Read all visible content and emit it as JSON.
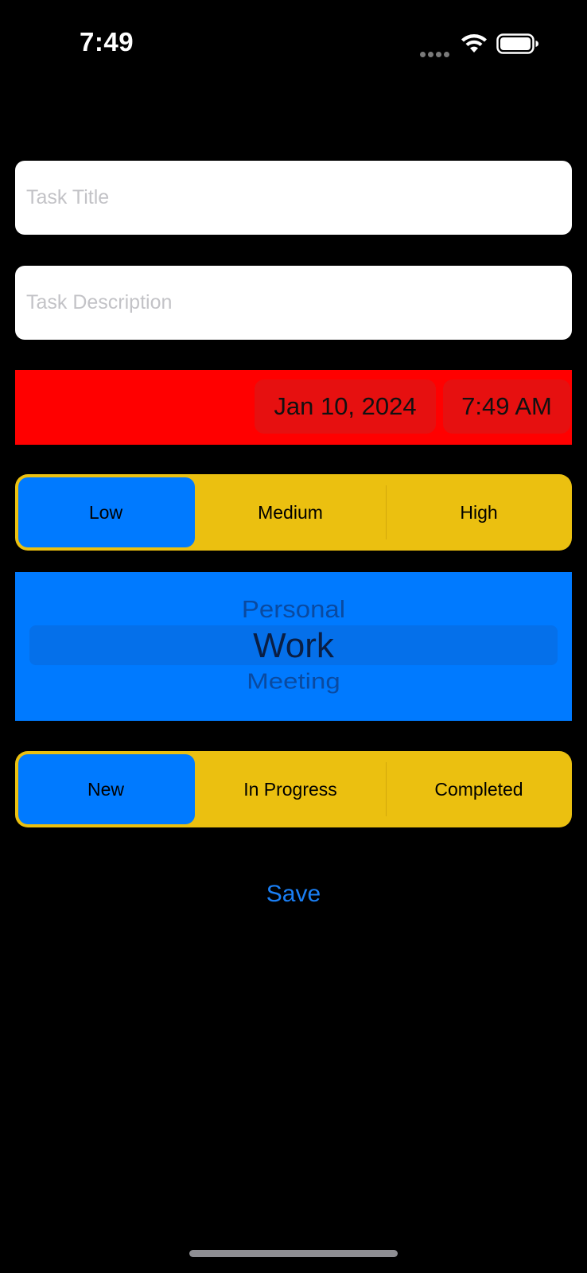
{
  "status_bar": {
    "time": "7:49",
    "icons": [
      "signal-dots-icon",
      "wifi-icon",
      "battery-icon"
    ]
  },
  "form": {
    "title_field": {
      "value": "",
      "placeholder": "Task Title"
    },
    "description_field": {
      "value": "",
      "placeholder": "Task Description"
    },
    "due": {
      "date": "Jan 10, 2024",
      "time": "7:49 AM"
    },
    "priority": {
      "options": [
        "Low",
        "Medium",
        "High"
      ],
      "selected": "Low"
    },
    "category": {
      "visible_options": [
        "Personal",
        "Work",
        "Meeting"
      ],
      "selected": "Work"
    },
    "status": {
      "options": [
        "New",
        "In Progress",
        "Completed"
      ],
      "selected": "New"
    },
    "save_label": "Save"
  },
  "colors": {
    "background": "#000000",
    "date_row": "#ff0000",
    "segmented_background": "#ebc010",
    "segment_selected": "#007aff",
    "picker_background": "#007aff",
    "save_text": "#1a7ff5"
  }
}
